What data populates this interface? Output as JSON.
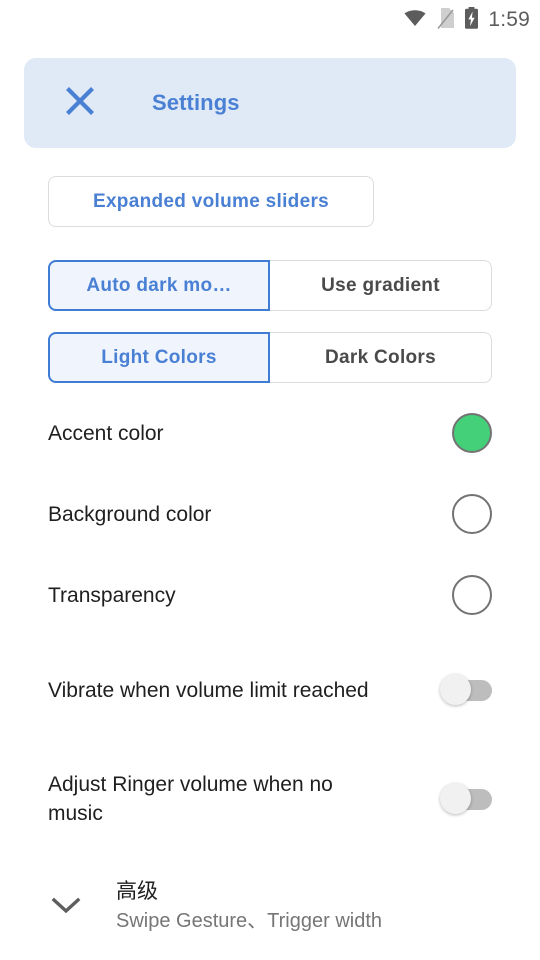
{
  "status_bar": {
    "icons": [
      "wifi-icon",
      "no-sim-icon",
      "battery-charging-icon"
    ],
    "time": "1:59"
  },
  "header": {
    "close_icon": "close-icon",
    "title": "Settings",
    "background_color": "#e0eaf7",
    "accent_text_color": "#4a80d4"
  },
  "pill_button": {
    "label": "Expanded volume sliders"
  },
  "segmented_controls": [
    {
      "name": "dark-mode-mode",
      "options": [
        {
          "label": "Auto dark mo…",
          "selected": true
        },
        {
          "label": "Use gradient",
          "selected": false
        }
      ]
    },
    {
      "name": "color-scheme",
      "options": [
        {
          "label": "Light Colors",
          "selected": true
        },
        {
          "label": "Dark Colors",
          "selected": false
        }
      ]
    }
  ],
  "settings": [
    {
      "name": "accent-color",
      "label": "Accent color",
      "control": "color-swatch",
      "swatch_color": "#44cf79"
    },
    {
      "name": "background-color",
      "label": "Background color",
      "control": "color-swatch",
      "swatch_color": "#ffffff"
    },
    {
      "name": "transparency",
      "label": "Transparency",
      "control": "color-swatch",
      "swatch_color": "#ffffff"
    },
    {
      "name": "vibrate-volume-limit",
      "label": "Vibrate when volume limit reached",
      "control": "toggle",
      "toggle_on": false
    },
    {
      "name": "adjust-ringer-no-music",
      "label": "Adjust Ringer volume when no music",
      "control": "toggle",
      "toggle_on": false
    }
  ],
  "advanced": {
    "chevron_icon": "chevron-down-icon",
    "title": "高级",
    "subtitle": "Swipe Gesture、Trigger width"
  },
  "colors": {
    "accent_blue": "#4a80d4",
    "selected_border": "#3f7cd4",
    "selected_fill": "#eff4fd",
    "unselected_border": "#dcdcdc",
    "text_primary": "#1f1f1f",
    "text_secondary": "#767676",
    "green_swatch": "#44cf79"
  }
}
